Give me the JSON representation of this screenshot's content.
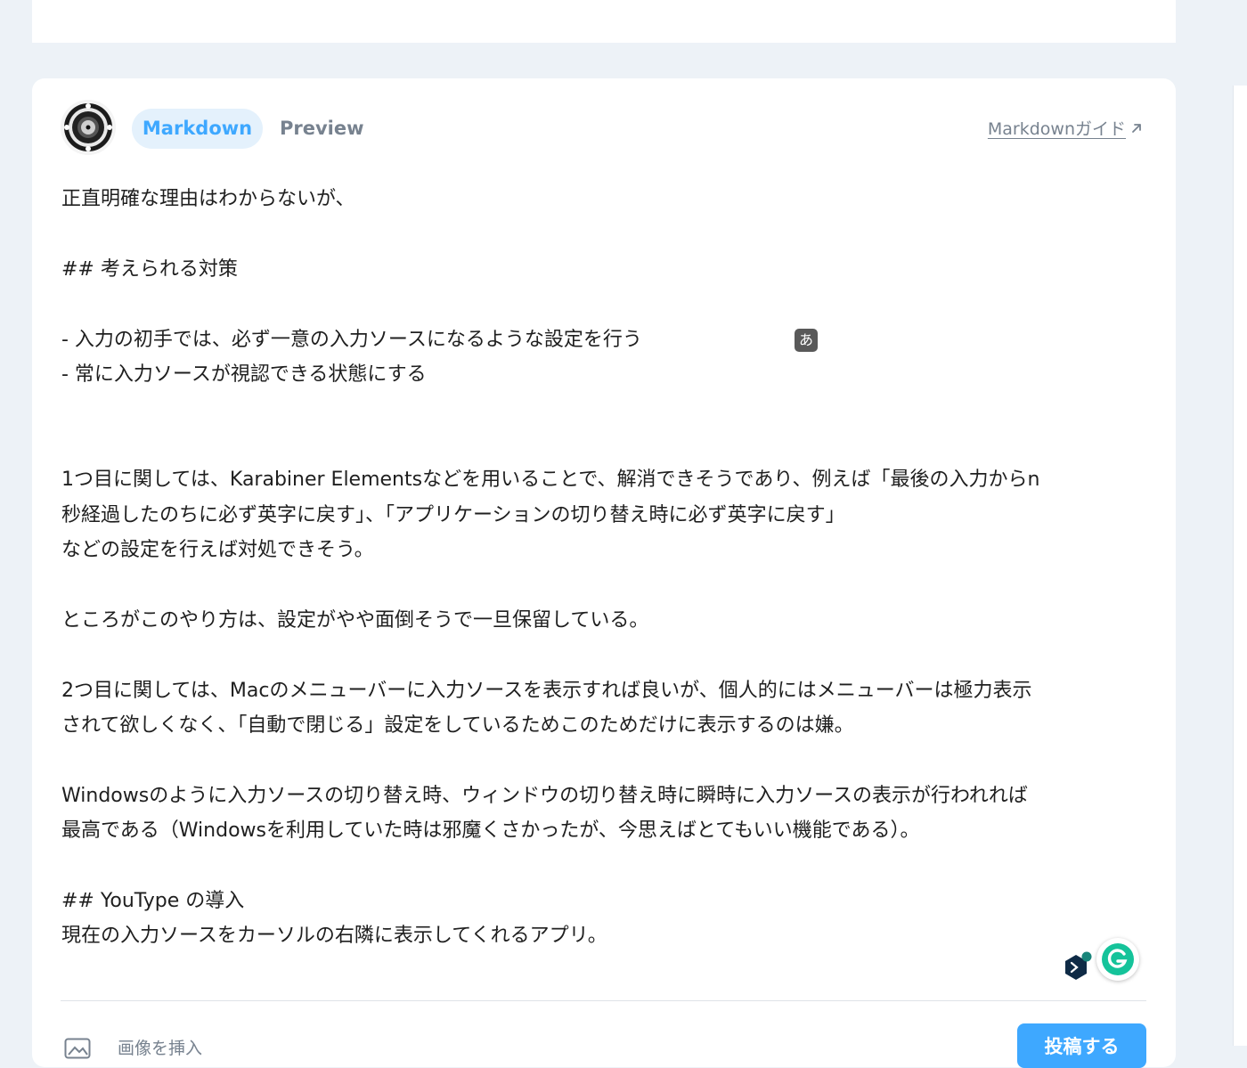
{
  "editor": {
    "tabs": {
      "markdown": "Markdown",
      "preview": "Preview"
    },
    "guide_link": "Markdownガイド",
    "guide_icon": "external-arrow-icon",
    "ime_indicator": "あ",
    "lines": [
      "正直明確な理由はわからないが、",
      "",
      "## 考えられる対策",
      "",
      "- 入力の初手では、必ず一意の入力ソースになるような設定を行う",
      "- 常に入力ソースが視認できる状態にする",
      "",
      "",
      "1つ目に関しては、Karabiner Elementsなどを用いることで、解消できそうであり、例えば「最後の入力からn",
      "秒経過したのちに必ず英字に戻す」、「アプリケーションの切り替え時に必ず英字に戻す」",
      "などの設定を行えば対処できそう。",
      "",
      "ところがこのやり方は、設定がやや面倒そうで一旦保留している。",
      "",
      "2つ目に関しては、Macのメニューバーに入力ソースを表示すれば良いが、個人的にはメニューバーは極力表示",
      "されて欲しくなく、「自動で閉じる」設定をしているためこのためだけに表示するのは嫌。",
      "",
      "Windowsのように入力ソースの切り替え時、ウィンドウの切り替え時に瞬時に入力ソースの表示が行われれば",
      "最高である（Windowsを利用していた時は邪魔くさかったが、今思えばとてもいい機能である）。",
      "",
      "## YouType の導入",
      "現在の入力ソースをカーソルの右隣に表示してくれるアプリ。"
    ]
  },
  "toolbar": {
    "image_label": "画像を挿入",
    "submit_label": "投稿する"
  },
  "colors": {
    "accent": "#3ea8ff",
    "accent_soft": "#e4f1fc",
    "muted_text": "#77828f",
    "page_background": "#edf2f7",
    "grammarly_green": "#15c39a",
    "deepl_navy": "#0f2b46"
  }
}
